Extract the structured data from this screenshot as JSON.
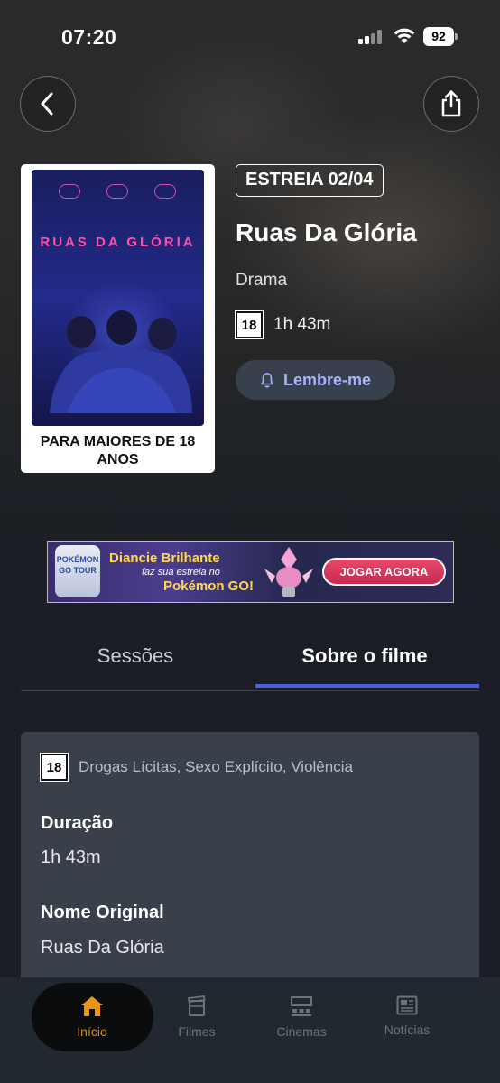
{
  "status_bar": {
    "time": "07:20",
    "battery": "92"
  },
  "header": {
    "back_icon": "chevron-left-icon",
    "share_icon": "share-icon"
  },
  "poster": {
    "title": "RUAS DA GLÓRIA",
    "age_notice": "PARA MAIORES DE 18 ANOS"
  },
  "movie": {
    "premiere_badge": "ESTREIA 02/04",
    "title": "Ruas Da Glória",
    "genre": "Drama",
    "age_rating": "18",
    "duration": "1h 43m",
    "remind_label": "Lembre-me"
  },
  "ad": {
    "logo_text": "POKÉMON GO TOUR",
    "title": "Diancie Brilhante",
    "subtitle": "faz sua estreia no",
    "brand": "Pokémon GO!",
    "cta": "JOGAR AGORA"
  },
  "tabs": [
    {
      "label": "Sessões",
      "active": false
    },
    {
      "label": "Sobre o filme",
      "active": true
    }
  ],
  "details": {
    "age_rating": "18",
    "content_warnings": "Drogas Lícitas, Sexo Explícito, Violência",
    "duration_label": "Duração",
    "duration_value": "1h 43m",
    "original_name_label": "Nome Original",
    "original_name_value": "Ruas Da Glória"
  },
  "bottom_nav": [
    {
      "label": "Início",
      "icon": "home-icon",
      "active": true
    },
    {
      "label": "Filmes",
      "icon": "film-icon",
      "active": false
    },
    {
      "label": "Cinemas",
      "icon": "cinema-icon",
      "active": false
    },
    {
      "label": "Notícias",
      "icon": "news-icon",
      "active": false
    }
  ],
  "colors": {
    "accent": "#4a5fe0",
    "remind_text": "#a8b4ff",
    "active_nav": "#d98a12",
    "background": "#1b1f25",
    "card": "#3a4049"
  }
}
